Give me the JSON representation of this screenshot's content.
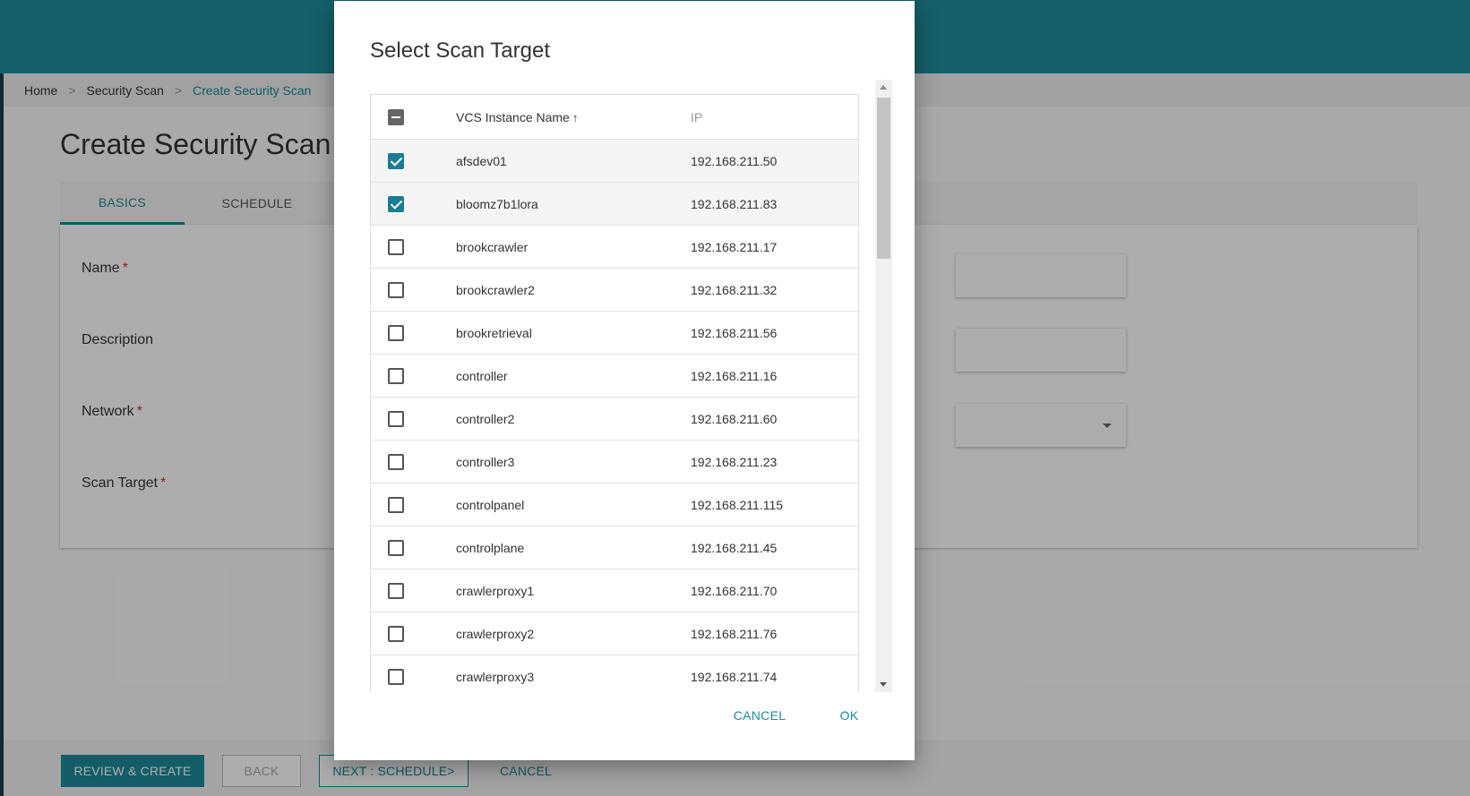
{
  "breadcrumb": [
    "Home",
    "Security Scan",
    "Create Security Scan"
  ],
  "page_title": "Create Security Scan",
  "tabs": [
    {
      "label": "BASICS",
      "active": true
    },
    {
      "label": "SCHEDULE",
      "active": false
    }
  ],
  "form": {
    "name_label": "Name",
    "description_label": "Description",
    "network_label": "Network",
    "scan_target_label": "Scan Target",
    "required_mark": "*"
  },
  "footer": {
    "review_create": "REVIEW & CREATE",
    "back": "BACK",
    "next": "NEXT : SCHEDULE>",
    "cancel": "CANCEL"
  },
  "dialog": {
    "title": "Select Scan Target",
    "columns": {
      "name": "VCS Instance Name",
      "ip": "IP"
    },
    "sort_arrow": "↑",
    "header_checkbox_state": "indeterminate",
    "rows": [
      {
        "name": "afsdev01",
        "ip": "192.168.211.50",
        "checked": true
      },
      {
        "name": "bloomz7b1lora",
        "ip": "192.168.211.83",
        "checked": true
      },
      {
        "name": "brookcrawler",
        "ip": "192.168.211.17",
        "checked": false
      },
      {
        "name": "brookcrawler2",
        "ip": "192.168.211.32",
        "checked": false
      },
      {
        "name": "brookretrieval",
        "ip": "192.168.211.56",
        "checked": false
      },
      {
        "name": "controller",
        "ip": "192.168.211.16",
        "checked": false
      },
      {
        "name": "controller2",
        "ip": "192.168.211.60",
        "checked": false
      },
      {
        "name": "controller3",
        "ip": "192.168.211.23",
        "checked": false
      },
      {
        "name": "controlpanel",
        "ip": "192.168.211.115",
        "checked": false
      },
      {
        "name": "controlplane",
        "ip": "192.168.211.45",
        "checked": false
      },
      {
        "name": "crawlerproxy1",
        "ip": "192.168.211.70",
        "checked": false
      },
      {
        "name": "crawlerproxy2",
        "ip": "192.168.211.76",
        "checked": false
      },
      {
        "name": "crawlerproxy3",
        "ip": "192.168.211.74",
        "checked": false
      }
    ],
    "cancel_label": "CANCEL",
    "ok_label": "OK"
  },
  "colors": {
    "accent": "#1b8a99",
    "topbar": "#1f8d9b",
    "checkbox_checked": "#1b7d95",
    "required": "#d32f2f"
  }
}
